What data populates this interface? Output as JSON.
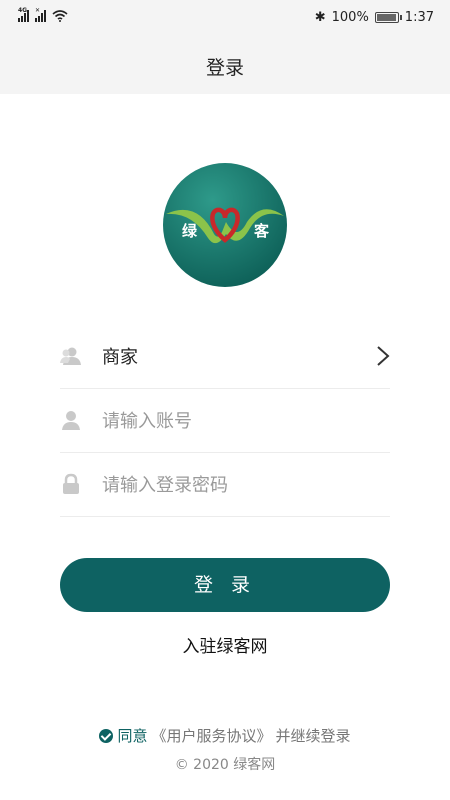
{
  "status_bar": {
    "net1": "4G",
    "net2": "✕",
    "bluetooth": "✱",
    "battery": "100%",
    "battery_level": 1.0,
    "time": "1:37"
  },
  "header": {
    "title": "登录"
  },
  "logo": {
    "left_char": "绿",
    "right_char": "客"
  },
  "form": {
    "role_value": "商家",
    "account_placeholder": "请输入账号",
    "password_placeholder": "请输入登录密码"
  },
  "login_button": "登 录",
  "register_link": "入驻绿客网",
  "agreement": {
    "agree": "同意",
    "terms": "《用户服务协议》",
    "suffix": "并继续登录"
  },
  "copyright": "© 2020 绿客网",
  "colors": {
    "primary": "#0e6262",
    "logo_green": "#1f7c6e",
    "heart_red": "#c8282a"
  }
}
